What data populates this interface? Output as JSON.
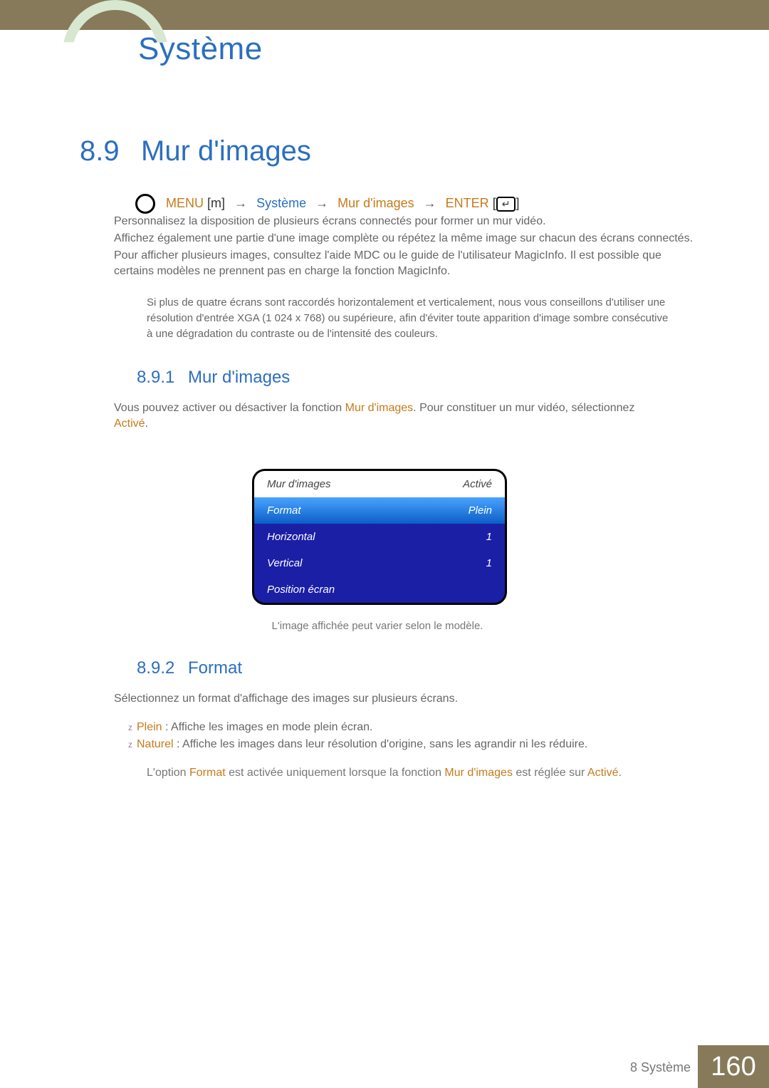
{
  "chapter_title": "Système",
  "section": {
    "num": "8.9",
    "title": "Mur d'images"
  },
  "nav": {
    "menu": "MENU",
    "menu_glyph": "m",
    "system": "Système",
    "mur": "Mur d'images",
    "enter": "ENTER",
    "enter_glyph": "↵"
  },
  "body_lines": [
    "Personnalisez la disposition de plusieurs écrans connectés pour former un mur vidéo.",
    "Affichez également une partie d'une image complète ou répétez la même image sur chacun des écrans connectés.",
    "Pour afficher plusieurs images, consultez l'aide MDC ou le guide de l'utilisateur MagicInfo. Il est possible que certains modèles ne prennent pas en charge la fonction MagicInfo."
  ],
  "note_lines": [
    "Si plus de quatre écrans sont raccordés horizontalement et verticalement, nous vous conseillons d'utiliser une résolution d'entrée XGA (1 024 x 768) ou supérieure, afin d'éviter toute apparition d'image sombre consécutive à une dégradation du contraste ou de l'intensité des couleurs."
  ],
  "sub1": {
    "num": "8.9.1",
    "title": "Mur d'images"
  },
  "para1_pre": "Vous pouvez activer ou désactiver la fonction ",
  "para1_hl": "Mur d'images",
  "para1_post": ". Pour constituer un mur vidéo, sélectionnez ",
  "active": "Activé",
  "menu_rows": [
    {
      "label": "Mur d'images",
      "value": "Activé",
      "kind": "sel"
    },
    {
      "label": "Format",
      "value": "Plein",
      "kind": "grad"
    },
    {
      "label": "Horizontal",
      "value": "1",
      "kind": "plain"
    },
    {
      "label": "Vertical",
      "value": "1",
      "kind": "plain"
    },
    {
      "label": "Position écran",
      "value": "",
      "kind": "plain"
    }
  ],
  "menu_caption": "L'image affichée peut varier selon le modèle.",
  "sub2": {
    "num": "8.9.2",
    "title": "Format"
  },
  "format_intro": "Sélectionnez un format d'affichage des images sur plusieurs écrans.",
  "bullets": [
    {
      "hl": "Plein",
      "rest": " : Affiche les images en mode plein écran."
    },
    {
      "hl": "Naturel",
      "rest": " : Affiche les images dans leur résolution d'origine, sans les agrandir ni les réduire."
    }
  ],
  "format_note_pre": "L'option ",
  "format_note_hl1": "Format",
  "format_note_mid": " est activée uniquement lorsque la fonction ",
  "format_note_hl2": "Mur d'images",
  "format_note_mid2": " est réglée sur ",
  "format_note_hl3": "Activé",
  "footer": {
    "label": "8 Système",
    "page": "160"
  }
}
